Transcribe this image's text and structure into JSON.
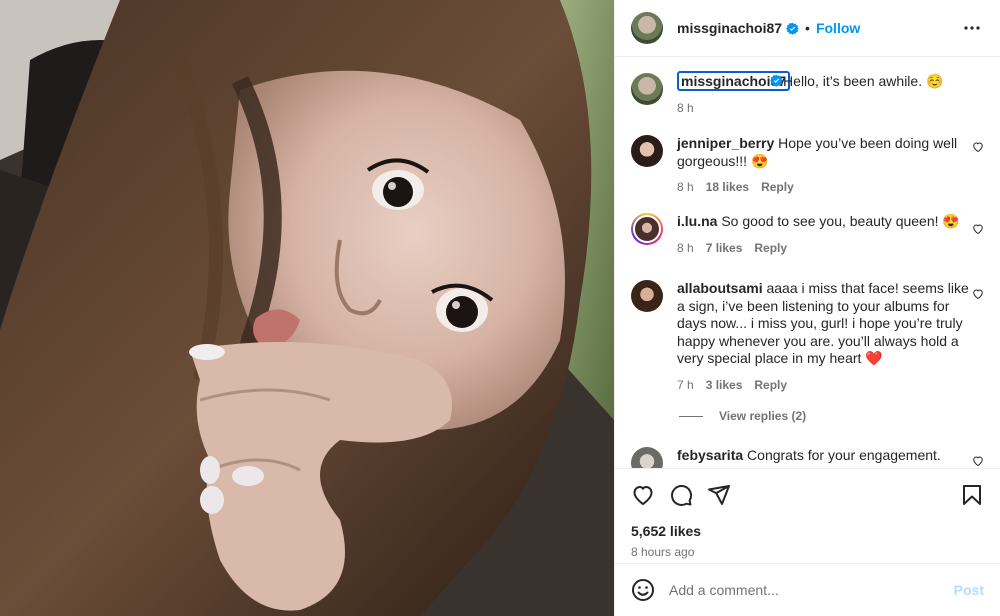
{
  "post": {
    "username": "missginachoi87",
    "follow_label": "Follow",
    "dot": "•"
  },
  "caption": {
    "username": "missginachoi87",
    "text": "Hello, it’s been awhile. ☺️",
    "time": "8 h"
  },
  "comments": [
    {
      "username": "jenniper_berry",
      "text": "Hope you’ve been doing well gorgeous!!! 😍",
      "time": "8 h",
      "likes": "18 likes",
      "reply": "Reply"
    },
    {
      "username": "i.lu.na",
      "text": "So good to see you, beauty queen! 😍",
      "time": "8 h",
      "likes": "7 likes",
      "reply": "Reply"
    },
    {
      "username": "allaboutsami",
      "text": "aaaa i miss that face! seems like a sign, i’ve been listening to your albums for days now... i miss you, gurl! i hope you’re truly happy whenever you are. you’ll always hold a very special place in my heart ❤️",
      "time": "7 h",
      "likes": "3 likes",
      "reply": "Reply",
      "view_replies": "View replies (2)"
    },
    {
      "username": "febysarita",
      "text": "Congrats for your engagement."
    }
  ],
  "stats": {
    "likes": "5,652 likes",
    "time_ago": "8 hours ago"
  },
  "add_comment": {
    "placeholder": "Add a comment...",
    "post_label": "Post"
  },
  "colors": {
    "accent": "#0095f6",
    "post_disabled": "#b2dffc",
    "selection_outline": "#0a5bd6"
  },
  "icons": [
    "more-icon",
    "verified-icon",
    "heart-icon",
    "comment-icon",
    "share-icon",
    "bookmark-icon",
    "emoji-icon"
  ]
}
